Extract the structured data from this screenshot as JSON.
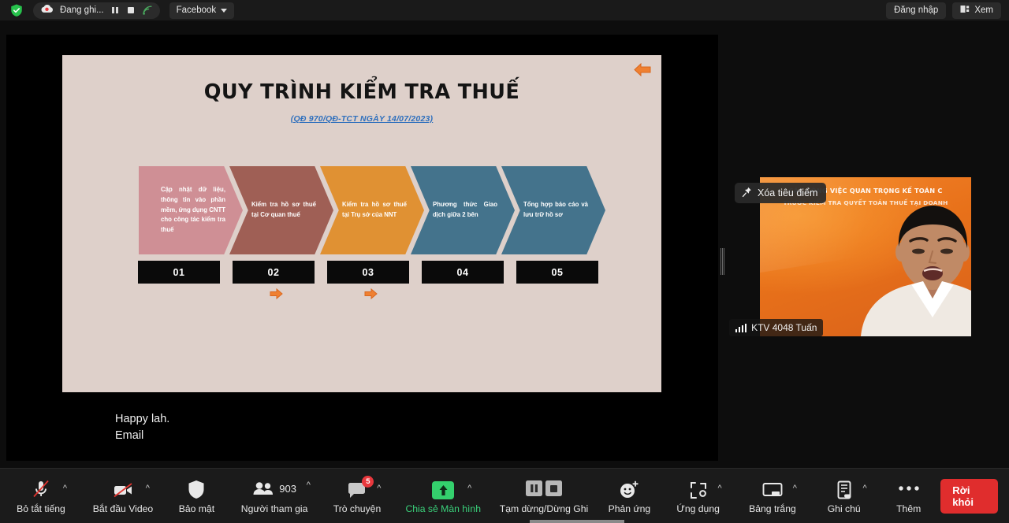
{
  "topbar": {
    "shield_icon": "shield-check-icon",
    "recording": {
      "cloud_icon": "cloud-record-icon",
      "label": "Đang ghi...",
      "pause_icon": "pause-icon",
      "stop_icon": "stop-icon",
      "stream_icon": "live-stream-icon"
    },
    "platform": {
      "label": "Facebook",
      "caret_icon": "caret-down-icon"
    },
    "right": {
      "signin_label": "Đăng nhập",
      "view_label": "Xem",
      "view_icon": "layout-view-icon"
    }
  },
  "share": {
    "back_arrow_icon": "left-arrow-icon",
    "slide": {
      "title": "QUY TRÌNH KIỂM TRA THUẾ",
      "subtitle": "(QĐ 970/QĐ-TCT NGÀY 14/07/2023)",
      "steps": [
        {
          "num": "01",
          "text": "Cập nhật dữ liệu, thông tin vào phần mềm, ứng dụng CNTT cho công tác kiểm tra thuế",
          "color": "#cf8f95"
        },
        {
          "num": "02",
          "text": "Kiểm tra hồ sơ thuế tại Cơ quan thuế",
          "color": "#9f5f55"
        },
        {
          "num": "03",
          "text": "Kiểm tra hồ sơ thuế tại Trụ sở của NNT",
          "color": "#e09133"
        },
        {
          "num": "04",
          "text": "Phương thức Giao dịch giữa 2 bên",
          "color": "#44738c"
        },
        {
          "num": "05",
          "text": "Tổng hợp báo cáo và lưu trữ hồ sơ",
          "color": "#44738c"
        }
      ],
      "flow_arrow_icon": "right-arrow-icon",
      "bg_color": "#ded0ca",
      "link_color": "#2e6fbd"
    },
    "caption_line1": "Happy lah.",
    "caption_line2": "Email",
    "drag_handle": "resize-handle"
  },
  "video": {
    "pin_chip": {
      "icon": "unpin-icon",
      "label": "Xóa tiêu điểm"
    },
    "overlay_line1": "CÁC CÔNG VIỆC QUAN TRỌNG KẾ TOÁN C",
    "overlay_line2": "TRƯỚC KIỂM TRA QUYẾT TOÁN THUẾ TẠI DOANH",
    "name_chip": {
      "signal_icon": "signal-bars-icon",
      "label": "KTV 4048 Tuấn"
    },
    "bg_color": "#e8711a"
  },
  "toolbar": {
    "items": [
      {
        "name": "unmute",
        "icon": "mic-muted-icon",
        "label": "Bỏ tắt tiếng",
        "caret": true,
        "badge": null,
        "count": null,
        "green": false
      },
      {
        "name": "start-video",
        "icon": "video-off-icon",
        "label": "Bắt đầu Video",
        "caret": true,
        "badge": null,
        "count": null,
        "green": false
      },
      {
        "name": "security",
        "icon": "shield-icon",
        "label": "Bảo mật",
        "caret": false,
        "badge": null,
        "count": null,
        "green": false
      },
      {
        "name": "participants",
        "icon": "people-icon",
        "label": "Người tham gia",
        "caret": true,
        "badge": null,
        "count": "903",
        "green": false
      },
      {
        "name": "chat",
        "icon": "chat-bubble-icon",
        "label": "Trò chuyện",
        "caret": true,
        "badge": "5",
        "count": null,
        "green": false
      },
      {
        "name": "share-screen",
        "icon": "share-screen-icon",
        "label": "Chia sẻ Màn hình",
        "caret": true,
        "badge": null,
        "count": null,
        "green": true
      },
      {
        "name": "pause-stop-record",
        "icon": "pause-stop-record-icon",
        "label": "Tạm dừng/Dừng Ghi",
        "caret": false,
        "badge": null,
        "count": null,
        "green": false
      },
      {
        "name": "reactions",
        "icon": "reaction-smiley-icon",
        "label": "Phản ứng",
        "caret": false,
        "badge": null,
        "count": null,
        "green": false
      },
      {
        "name": "apps",
        "icon": "apps-icon",
        "label": "Ứng dụng",
        "caret": true,
        "badge": null,
        "count": null,
        "green": false
      },
      {
        "name": "whiteboard",
        "icon": "whiteboard-icon",
        "label": "Bảng trắng",
        "caret": true,
        "badge": null,
        "count": null,
        "green": false
      },
      {
        "name": "notes",
        "icon": "notes-icon",
        "label": "Ghi chú",
        "caret": true,
        "badge": null,
        "count": null,
        "green": false
      },
      {
        "name": "more",
        "icon": "ellipsis-icon",
        "label": "Thêm",
        "caret": false,
        "badge": null,
        "count": null,
        "green": false
      }
    ],
    "leave_label": "Rời khỏi",
    "accent_green": "#3ad07a",
    "leave_color": "#e02d2d"
  }
}
